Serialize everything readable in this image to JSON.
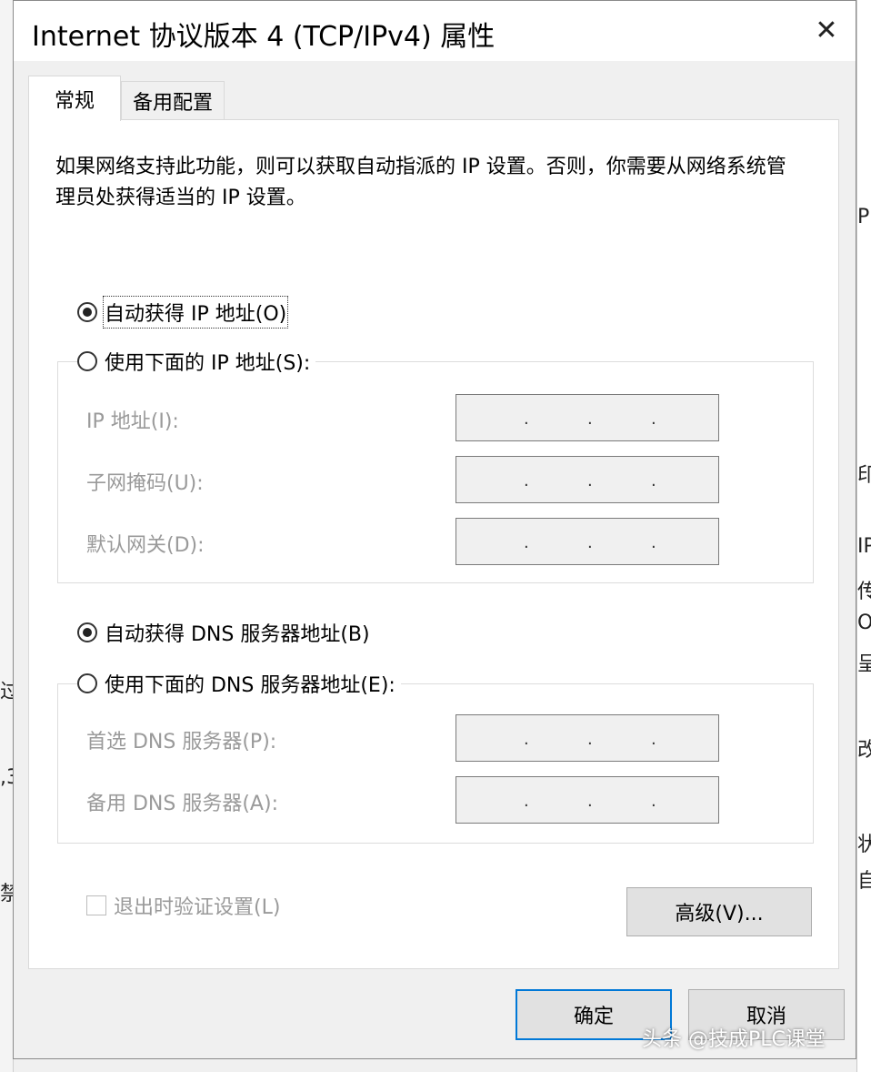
{
  "background": {
    "right_fragments": [
      "P",
      "印",
      "IP",
      "传",
      "OC",
      "呈",
      "改",
      "状",
      "自"
    ],
    "left_fragments": [
      "过",
      ",3",
      "禁"
    ]
  },
  "dialog": {
    "title": "Internet 协议版本 4 (TCP/IPv4) 属性",
    "close_glyph": "✕"
  },
  "tabs": {
    "general": "常规",
    "alternate": "备用配置"
  },
  "description": "如果网络支持此功能，则可以获取自动指派的 IP 设置。否则，你需要从网络系统管理员处获得适当的 IP 设置。",
  "ip": {
    "auto_label": "自动获得 IP 地址(O)",
    "auto_checked": true,
    "manual_label": "使用下面的 IP 地址(S):",
    "manual_checked": false,
    "fields": {
      "address_label": "IP 地址(I):",
      "subnet_label": "子网掩码(U):",
      "gateway_label": "默认网关(D):"
    }
  },
  "dns": {
    "auto_label": "自动获得 DNS 服务器地址(B)",
    "auto_checked": true,
    "manual_label": "使用下面的 DNS 服务器地址(E):",
    "manual_checked": false,
    "fields": {
      "preferred_label": "首选 DNS 服务器(P):",
      "alternate_label": "备用 DNS 服务器(A):"
    }
  },
  "ip_dot": ".",
  "validate_label": "退出时验证设置(L)",
  "validate_checked": false,
  "buttons": {
    "advanced": "高级(V)...",
    "ok": "确定",
    "cancel": "取消"
  },
  "watermark": "头条 @技成PLC课堂",
  "colors": {
    "focus_border": "#0078d7",
    "disabled_text": "#9a9a9a",
    "window_bg": "#f0f0f0"
  }
}
